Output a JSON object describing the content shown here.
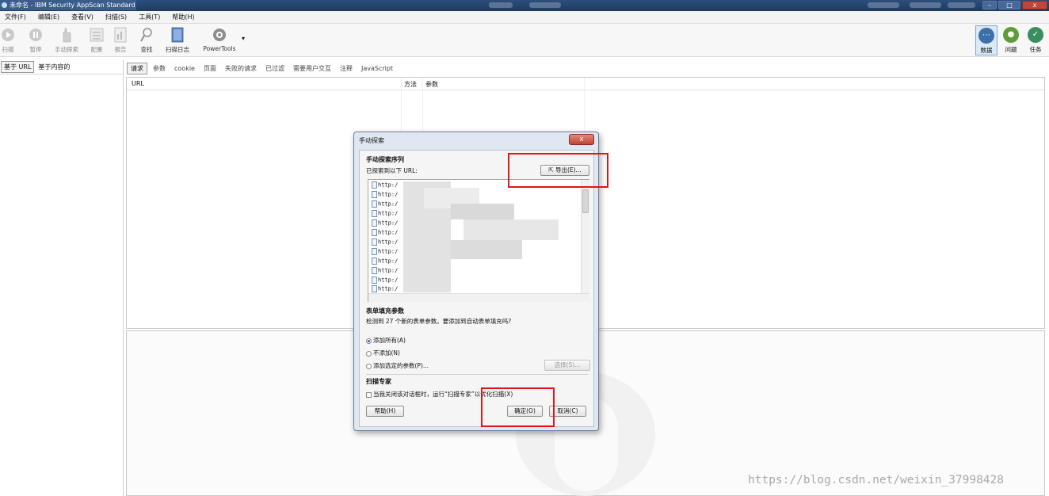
{
  "window": {
    "title": "未命名 - IBM Security AppScan Standard"
  },
  "menu": [
    "文件(F)",
    "编辑(E)",
    "查看(V)",
    "扫描(S)",
    "工具(T)",
    "帮助(H)"
  ],
  "toolbar": {
    "scan": "扫描",
    "pause": "暂停",
    "manual": "手动探索",
    "config": "配置",
    "report": "报告",
    "find": "查找",
    "scanlog": "扫描日志",
    "powertools": "PowerTools"
  },
  "right_tools": {
    "data": "数据",
    "issues": "问题",
    "tasks": "任务"
  },
  "left_tabs": {
    "by_url": "基于 URL",
    "by_content": "基于内容的"
  },
  "main_tabs": [
    "请求",
    "参数",
    "cookie",
    "页面",
    "失败的请求",
    "已过滤",
    "需要用户交互",
    "注释",
    "JavaScript"
  ],
  "table_headers": {
    "url": "URL",
    "method": "方法",
    "params": "参数"
  },
  "dialog": {
    "title": "手动探索",
    "close": "x",
    "seq_header": "手动探索序列",
    "seq_desc": "已探索到以下 URL:",
    "export": "导出(E)...",
    "urls": [
      "http:/",
      "http:/",
      "http:/",
      "http:/",
      "http:/",
      "http:/",
      "http:/",
      "http:/",
      "http:/",
      "http:/",
      "http:/",
      "http:/"
    ],
    "form_header": "表单填充参数",
    "form_desc": "检测到 27 个新的表单参数。要添加到自动表单填充吗?",
    "opt_all": "添加所有(A)",
    "opt_none": "不添加(N)",
    "opt_selected": "添加选定的参数(P)...",
    "select_btn": "选择(S)...",
    "expert_header": "扫描专家",
    "expert_check": "当我关闭该对话框时，运行“扫描专家”以优化扫描(X)",
    "help": "帮助(H)",
    "ok": "确定(O)",
    "cancel": "取消(C)"
  },
  "watermark": "https://blog.csdn.net/weixin_37998428",
  "colors": {
    "highlight": "#e01515",
    "titlebar": "#1f3a5f",
    "data_icon": "#3d6fa8",
    "issues_icon": "#5f9d3a",
    "tasks_icon": "#3a8d5c"
  }
}
